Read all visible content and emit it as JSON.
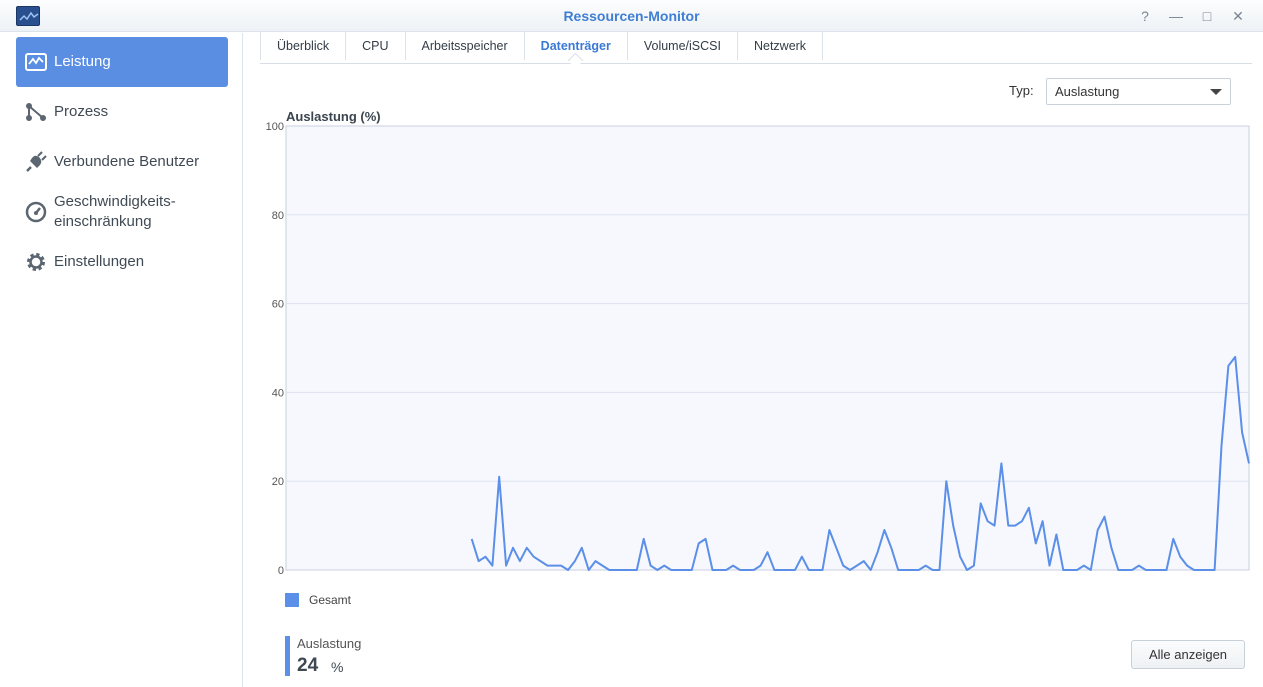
{
  "window": {
    "title": "Ressourcen-Monitor",
    "controls": [
      "?",
      "—",
      "□",
      "✕"
    ]
  },
  "sidebar": {
    "items": [
      {
        "label": "Leistung",
        "icon": "performance-icon",
        "active": true
      },
      {
        "label": "Prozess",
        "icon": "process-icon",
        "active": false
      },
      {
        "label": "Verbundene Benutzer",
        "icon": "plug-icon",
        "active": false
      },
      {
        "label": "Geschwindigkeits-\neinschränkung",
        "label_line1": "Geschwindigkeits-",
        "label_line2": "einschränkung",
        "icon": "speedometer-icon",
        "active": false
      },
      {
        "label": "Einstellungen",
        "icon": "gear-icon",
        "active": false
      }
    ]
  },
  "tabs": [
    {
      "label": "Überblick",
      "active": false
    },
    {
      "label": "CPU",
      "active": false
    },
    {
      "label": "Arbeitsspeicher",
      "active": false
    },
    {
      "label": "Datenträger",
      "active": true
    },
    {
      "label": "Volume/iSCSI",
      "active": false
    },
    {
      "label": "Netzwerk",
      "active": false
    }
  ],
  "type_selector": {
    "label": "Typ:",
    "value": "Auslastung"
  },
  "chart_data": {
    "type": "line",
    "title": "Auslastung (%)",
    "ylim": [
      0,
      100
    ],
    "yticks": [
      0,
      20,
      40,
      60,
      80,
      100
    ],
    "grid": true,
    "legend_position": "bottom-left",
    "series": [
      {
        "name": "Gesamt",
        "color": "#5b8fe8",
        "values": [
          null,
          null,
          null,
          null,
          null,
          null,
          null,
          null,
          null,
          null,
          null,
          null,
          null,
          null,
          null,
          null,
          null,
          null,
          null,
          null,
          null,
          null,
          null,
          null,
          null,
          null,
          null,
          7,
          2,
          3,
          1,
          21,
          1,
          5,
          2,
          5,
          3,
          2,
          1,
          1,
          1,
          0,
          2,
          5,
          0,
          2,
          1,
          0,
          0,
          0,
          0,
          0,
          7,
          1,
          0,
          1,
          0,
          0,
          0,
          0,
          6,
          7,
          0,
          0,
          0,
          1,
          0,
          0,
          0,
          1,
          4,
          0,
          0,
          0,
          0,
          3,
          0,
          0,
          0,
          9,
          5,
          1,
          0,
          1,
          2,
          0,
          4,
          9,
          5,
          0,
          0,
          0,
          0,
          1,
          0,
          0,
          20,
          10,
          3,
          0,
          1,
          15,
          11,
          10,
          24,
          10,
          10,
          11,
          14,
          6,
          11,
          1,
          8,
          0,
          0,
          0,
          1,
          0,
          9,
          12,
          5,
          0,
          0,
          0,
          1,
          0,
          0,
          0,
          0,
          7,
          3,
          1,
          0,
          0,
          0,
          0,
          28,
          46,
          48,
          31,
          24
        ]
      }
    ]
  },
  "legend": {
    "label": "Gesamt",
    "color": "#5b8fe8"
  },
  "current": {
    "label": "Auslastung",
    "value": "24",
    "unit": "%"
  },
  "show_all_button": "Alle anzeigen",
  "colors": {
    "accent": "#5a8ee3",
    "series": "#5b8fe8",
    "title": "#3f7fd3"
  }
}
